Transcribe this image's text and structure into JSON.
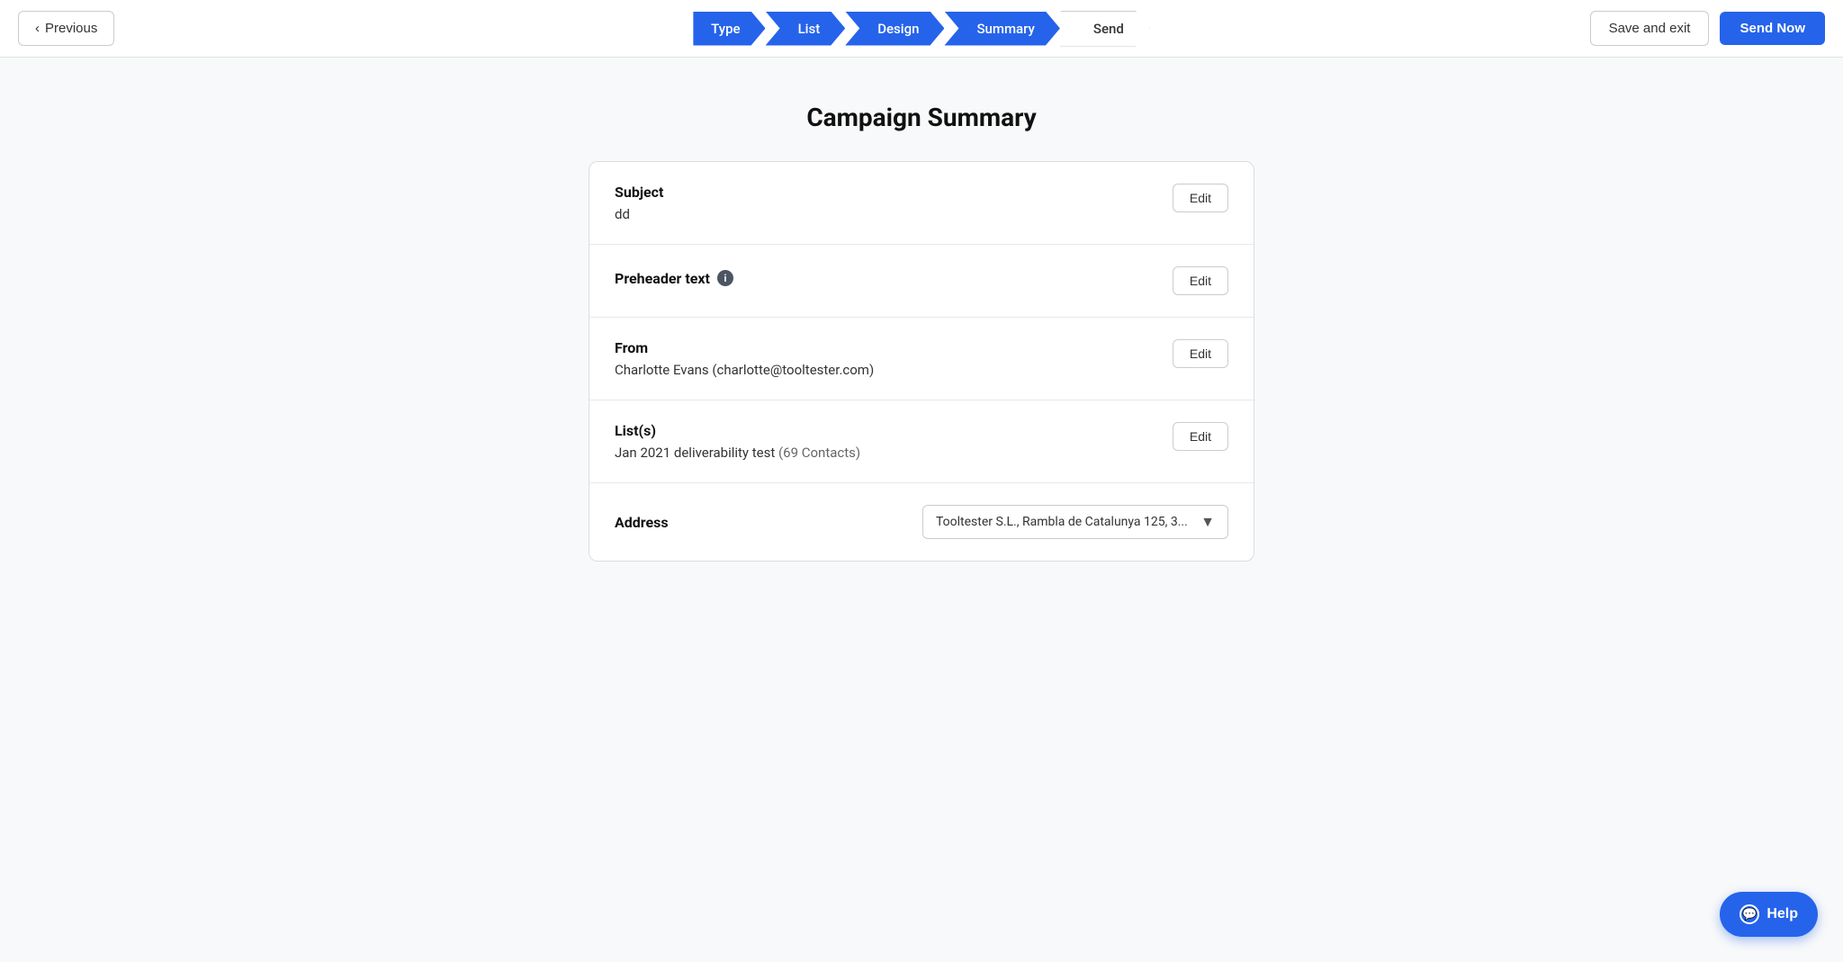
{
  "header": {
    "previous_label": "Previous",
    "save_exit_label": "Save and exit",
    "send_now_label": "Send Now"
  },
  "stepper": {
    "steps": [
      {
        "id": "type",
        "label": "Type",
        "state": "completed"
      },
      {
        "id": "list",
        "label": "List",
        "state": "completed"
      },
      {
        "id": "design",
        "label": "Design",
        "state": "completed"
      },
      {
        "id": "summary",
        "label": "Summary",
        "state": "completed"
      },
      {
        "id": "send",
        "label": "Send",
        "state": "active"
      }
    ]
  },
  "page": {
    "title": "Campaign Summary"
  },
  "summary": {
    "subject": {
      "label": "Subject",
      "value": "dd",
      "edit_label": "Edit"
    },
    "preheader": {
      "label": "Preheader text",
      "value": "",
      "edit_label": "Edit"
    },
    "from": {
      "label": "From",
      "value": "Charlotte Evans (charlotte@tooltester.com)",
      "edit_label": "Edit"
    },
    "lists": {
      "label": "List(s)",
      "list_name": "Jan 2021 deliverability test",
      "contacts": "(69 Contacts)",
      "edit_label": "Edit"
    },
    "address": {
      "label": "Address",
      "dropdown_value": "Tooltester S.L., Rambla de Catalunya 125, 3..."
    }
  },
  "help": {
    "label": "Help"
  }
}
